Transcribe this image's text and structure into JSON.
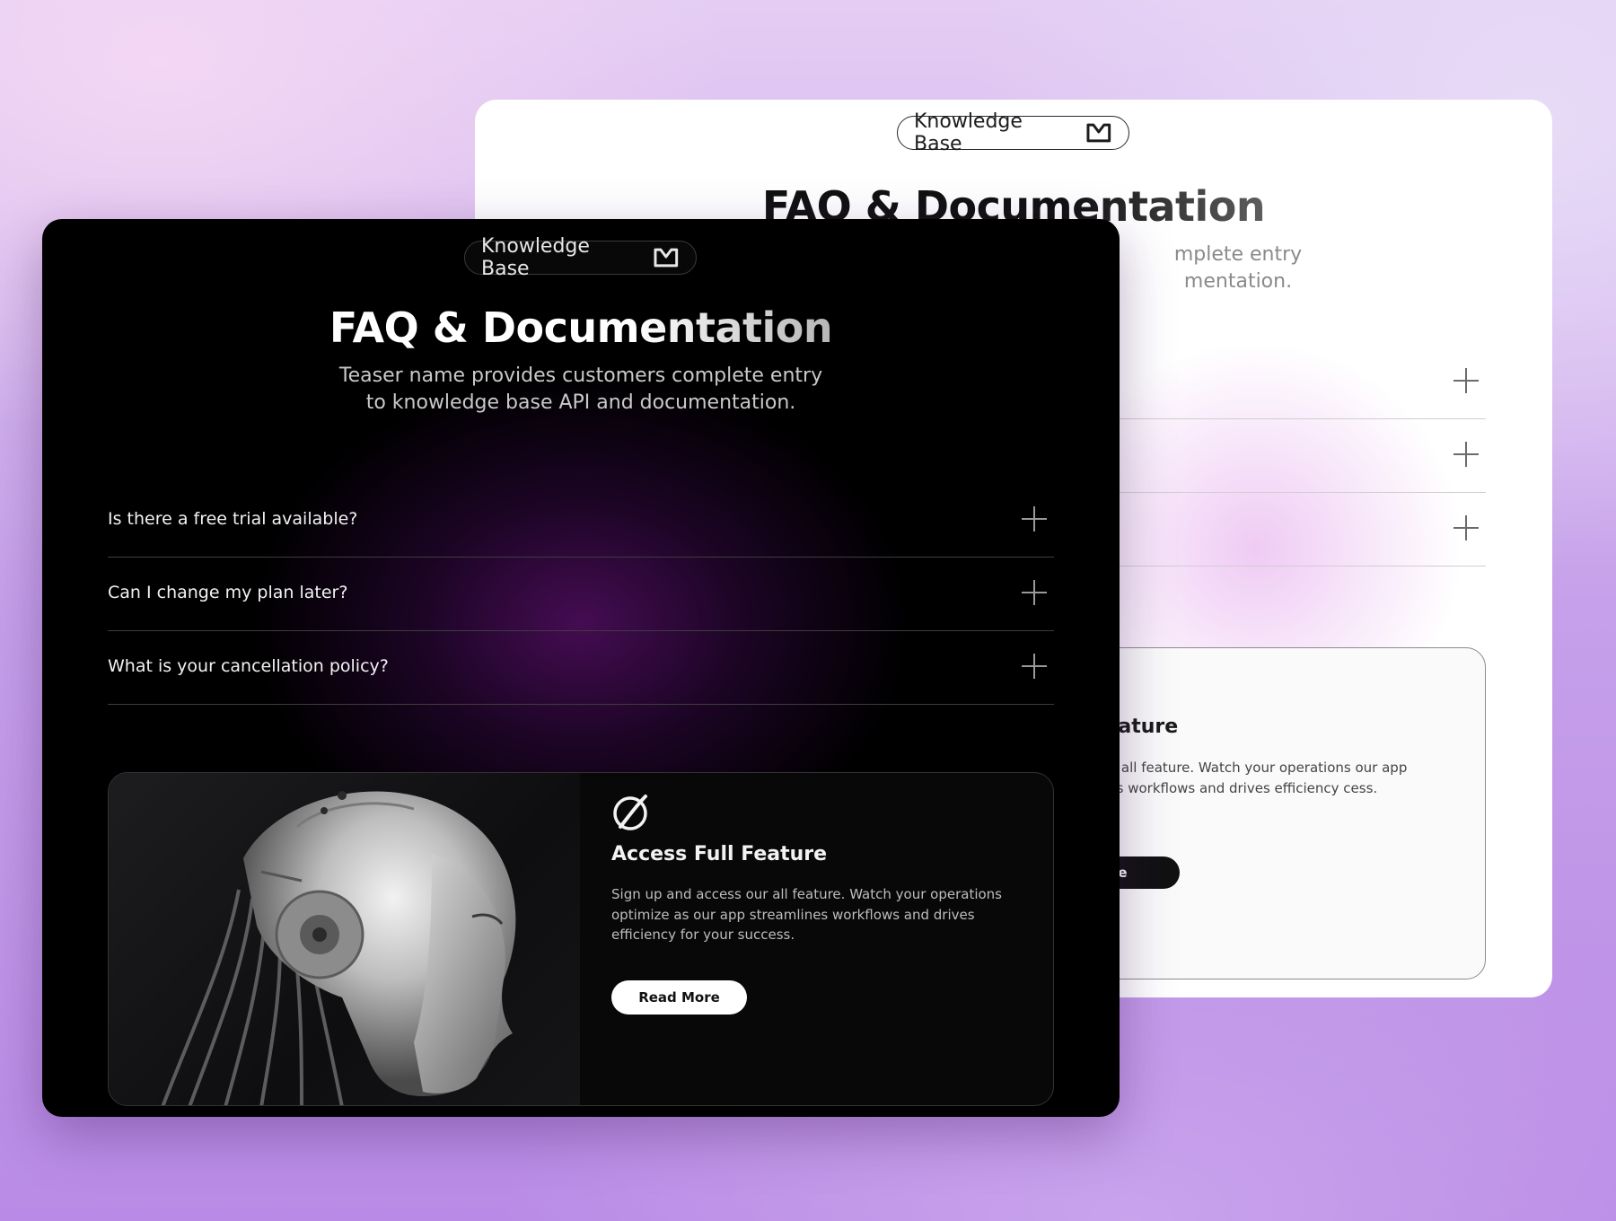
{
  "light_card": {
    "badge_label": "Knowledge Base",
    "title": "FAQ & Documentation",
    "subtitle_line1": "mplete entry",
    "subtitle_line2": "mentation.",
    "feature_title": "Full Feature",
    "feature_text": "access our all feature. Watch your operations our app streamlines workflows and drives efficiency cess.",
    "feature_button": "lore"
  },
  "dark_card": {
    "badge_label": "Knowledge Base",
    "title": "FAQ & Documentation",
    "subtitle_line1": "Teaser name provides customers complete entry",
    "subtitle_line2": "to knowledge base API and documentation.",
    "faq": [
      {
        "question": "Is there a free trial available?"
      },
      {
        "question": "Can I change my plan later?"
      },
      {
        "question": "What is your cancellation policy?"
      }
    ],
    "feature": {
      "title": "Access Full Feature",
      "text": "Sign up and access our all feature. Watch your operations optimize as our app streamlines workflows and drives efficiency for your success.",
      "button": "Read More"
    }
  },
  "icons": {
    "badge": "book-icon",
    "faq_toggle": "plus-icon",
    "feature": "slashed-circle-logo-icon"
  }
}
